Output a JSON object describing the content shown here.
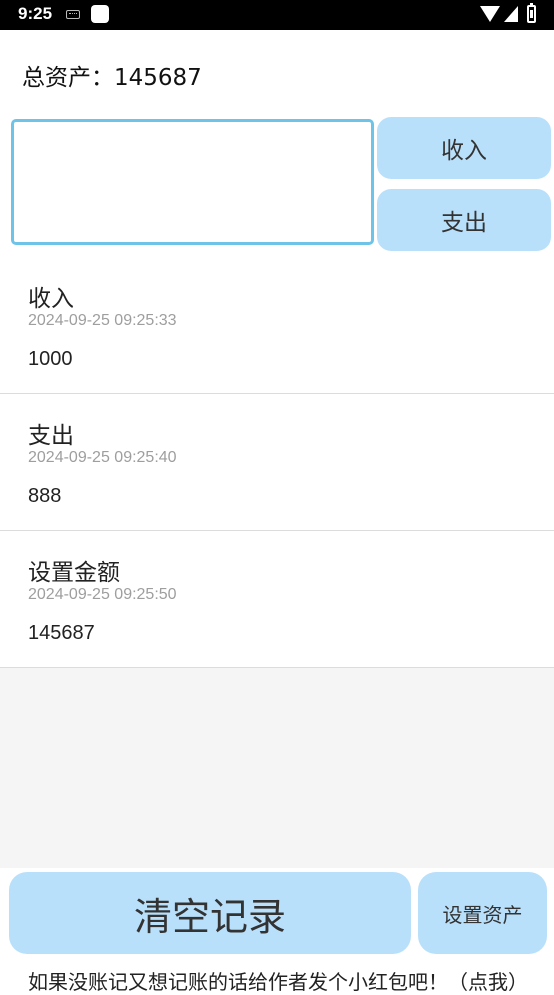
{
  "status_bar": {
    "time": "9:25",
    "icons": [
      "keyboard-icon",
      "notification-icon",
      "wifi-icon",
      "signal-icon",
      "battery-icon"
    ]
  },
  "summary": {
    "label": "总资产：",
    "value": "145687"
  },
  "input": {
    "value": "",
    "placeholder": ""
  },
  "actions": {
    "income_label": "收入",
    "expense_label": "支出"
  },
  "records": [
    {
      "type": "收入",
      "time": "2024-09-25 09:25:33",
      "amount": "1000"
    },
    {
      "type": "支出",
      "time": "2024-09-25 09:25:40",
      "amount": "888"
    },
    {
      "type": "设置金额",
      "time": "2024-09-25 09:25:50",
      "amount": "145687"
    }
  ],
  "bottom": {
    "clear_label": "清空记录",
    "set_assets_label": "设置资产",
    "note": "如果没账记又想记账的话给作者发个小红包吧！（点我）"
  },
  "colors": {
    "button_bg": "#b9e0fb",
    "input_border": "#6ec3e8",
    "list_bg": "#f5f5f5"
  }
}
